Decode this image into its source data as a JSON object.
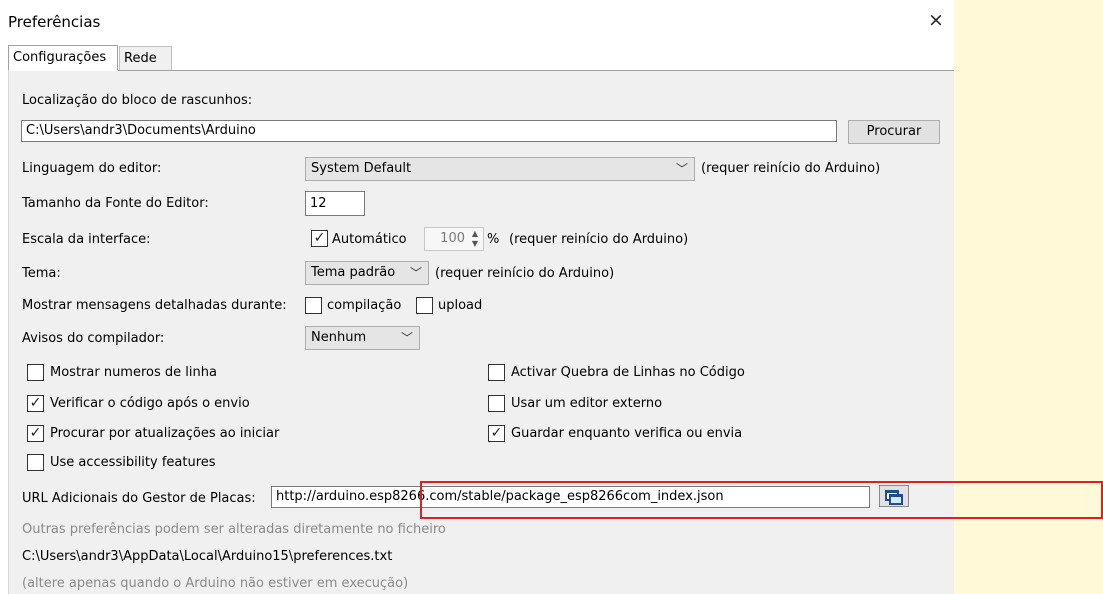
{
  "window": {
    "title": "Preferências",
    "close_glyph": "×"
  },
  "tabs": [
    {
      "label": "Configurações",
      "active": true
    },
    {
      "label": "Rede",
      "active": false
    }
  ],
  "sketchbook": {
    "label": "Localização do bloco de rascunhos:",
    "value": "C:\\Users\\andr3\\Documents\\Arduino",
    "browse_label": "Procurar"
  },
  "editor_language": {
    "label": "Linguagem do editor:",
    "value": "System Default",
    "note": "(requer reinício do Arduino)"
  },
  "font_size": {
    "label": "Tamanho da Fonte do Editor:",
    "value": "12"
  },
  "scale": {
    "label": "Escala da interface:",
    "auto_label": "Automático",
    "auto_checked": true,
    "value": "100",
    "unit": "%",
    "note": "(requer reinício do Arduino)"
  },
  "theme": {
    "label": "Tema:",
    "value": "Tema padrão",
    "note": "(requer reinício do Arduino)"
  },
  "verbose": {
    "label": "Mostrar mensagens detalhadas durante:",
    "compile_label": "compilação",
    "compile_checked": false,
    "upload_label": "upload",
    "upload_checked": false
  },
  "warnings": {
    "label": "Avisos do compilador:",
    "value": "Nenhum"
  },
  "options": {
    "line_numbers": {
      "label": "Mostrar numeros de linha",
      "checked": false
    },
    "verify_after_upload": {
      "label": "Verificar o código após o envio",
      "checked": true
    },
    "check_updates": {
      "label": "Procurar por atualizações ao iniciar",
      "checked": true
    },
    "accessibility": {
      "label": "Use accessibility features",
      "checked": false
    },
    "code_folding": {
      "label": "Activar Quebra de Linhas no Código",
      "checked": false
    },
    "external_editor": {
      "label": "Usar um editor externo",
      "checked": false
    },
    "save_on_verify": {
      "label": "Guardar enquanto verifica ou envia",
      "checked": true
    }
  },
  "boards_url": {
    "label": "URL Adicionais do Gestor de Placas:",
    "value": "http://arduino.esp8266.com/stable/package_esp8266com_index.json",
    "button_icon": "open-window-icon"
  },
  "footer": {
    "more_prefs": "Outras preferências podem ser alteradas diretamente no ficheiro",
    "prefs_path": "C:\\Users\\andr3\\AppData\\Local\\Arduino15\\preferences.txt",
    "edit_note": "(altere apenas quando o Arduino não estiver em execução)"
  },
  "colors": {
    "highlight_box": "#e02020",
    "background": "#fff9d8",
    "panel": "#f0f0f0"
  },
  "check_glyph": "✓"
}
